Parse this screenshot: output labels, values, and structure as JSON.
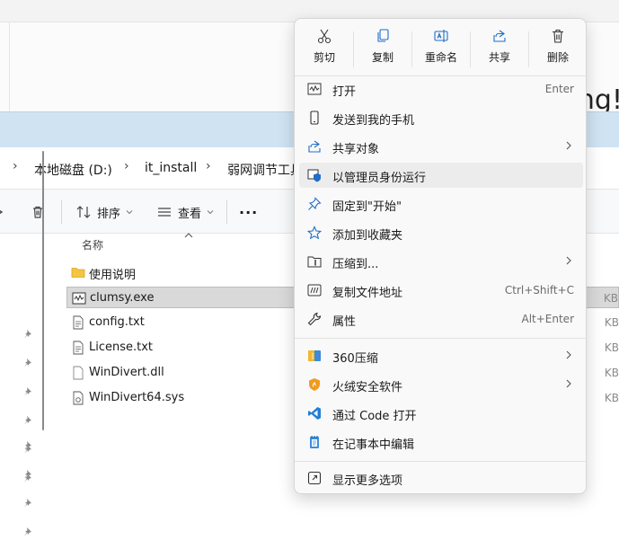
{
  "background_window": {
    "partial_text": "ng!"
  },
  "breadcrumb": {
    "items": [
      "本地磁盘 (D:)",
      "it_install",
      "弱网调节工具"
    ]
  },
  "toolbar": {
    "sort_label": "排序",
    "view_label": "查看",
    "more_label": "···"
  },
  "file_list": {
    "column_name": "名称",
    "files": [
      {
        "name": "使用说明",
        "type": "folder",
        "size": ""
      },
      {
        "name": "clumsy.exe",
        "type": "exe",
        "size": "KB"
      },
      {
        "name": "config.txt",
        "type": "txt",
        "size": "KB"
      },
      {
        "name": "License.txt",
        "type": "txt",
        "size": "KB"
      },
      {
        "name": "WinDivert.dll",
        "type": "dll",
        "size": "KB"
      },
      {
        "name": "WinDivert64.sys",
        "type": "sys",
        "size": "KB"
      }
    ]
  },
  "context_menu": {
    "quick_actions": [
      {
        "label": "剪切",
        "icon": "scissors-icon"
      },
      {
        "label": "复制",
        "icon": "copy-icon"
      },
      {
        "label": "重命名",
        "icon": "rename-icon"
      },
      {
        "label": "共享",
        "icon": "share-icon"
      },
      {
        "label": "删除",
        "icon": "trash-icon"
      }
    ],
    "items": [
      {
        "label": "打开",
        "shortcut": "Enter",
        "icon": "open-app-icon"
      },
      {
        "label": "发送到我的手机",
        "shortcut": "",
        "icon": "phone-icon"
      },
      {
        "label": "共享对象",
        "shortcut": "",
        "icon": "share-icon",
        "submenu": true
      },
      {
        "label": "以管理员身份运行",
        "shortcut": "",
        "icon": "shield-admin-icon"
      },
      {
        "label": "固定到\"开始\"",
        "shortcut": "",
        "icon": "pin-icon"
      },
      {
        "label": "添加到收藏夹",
        "shortcut": "",
        "icon": "star-icon"
      },
      {
        "label": "压缩到...",
        "shortcut": "",
        "icon": "zip-folder-icon",
        "submenu": true
      },
      {
        "label": "复制文件地址",
        "shortcut": "Ctrl+Shift+C",
        "icon": "copy-path-icon"
      },
      {
        "label": "属性",
        "shortcut": "Alt+Enter",
        "icon": "wrench-icon"
      },
      {
        "label": "360压缩",
        "shortcut": "",
        "icon": "360-zip-icon",
        "submenu": true
      },
      {
        "label": "火绒安全软件",
        "shortcut": "",
        "icon": "huorong-icon",
        "submenu": true
      },
      {
        "label": "通过 Code 打开",
        "shortcut": "",
        "icon": "vscode-icon"
      },
      {
        "label": "在记事本中编辑",
        "shortcut": "",
        "icon": "notepad-icon"
      },
      {
        "label": "显示更多选项",
        "shortcut": "",
        "icon": "more-options-icon"
      }
    ]
  },
  "colors": {
    "accent_blue": "#1f6fc8",
    "titlebar": "#cfe3f3",
    "menu_bg": "#f9f9f9",
    "hover": "#ececec"
  }
}
